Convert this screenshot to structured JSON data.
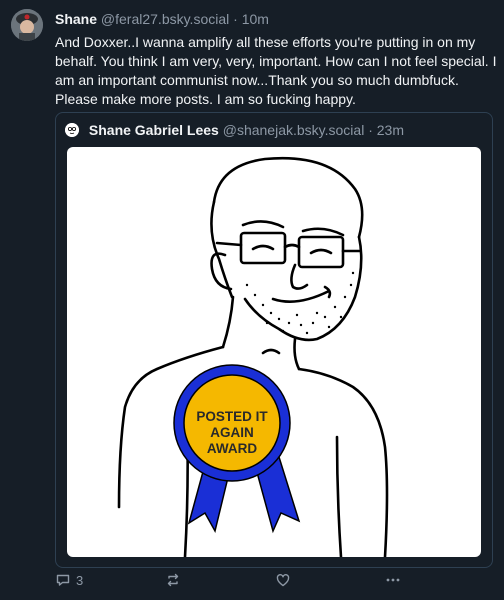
{
  "post": {
    "author_name": "Shane",
    "author_handle": "@feral27.bsky.social",
    "separator": "·",
    "time": "10m",
    "text": "And Doxxer..I wanna amplify all these efforts you're putting in on my behalf. You think I am very, very, important. How can I not feel special. I am an important communist now...Thank you so much dumbfuck. Please make more posts. I am so fucking happy."
  },
  "quote": {
    "author_name": "Shane Gabriel Lees",
    "author_handle": "@shanejak.bsky.social",
    "separator": "·",
    "time": "23m",
    "image": {
      "award_lines": [
        "POSTED IT",
        "AGAIN",
        "AWARD"
      ],
      "colors": {
        "ribbon": "#1a2fd6",
        "medal": "#f5b800"
      }
    }
  },
  "actions": {
    "reply_count": "3",
    "icons": [
      "reply-icon",
      "repost-icon",
      "like-icon",
      "more-icon"
    ]
  },
  "colors": {
    "background": "#161e27",
    "text": "#f1f3f5",
    "muted": "#8d98a5",
    "border": "#2e4052"
  }
}
